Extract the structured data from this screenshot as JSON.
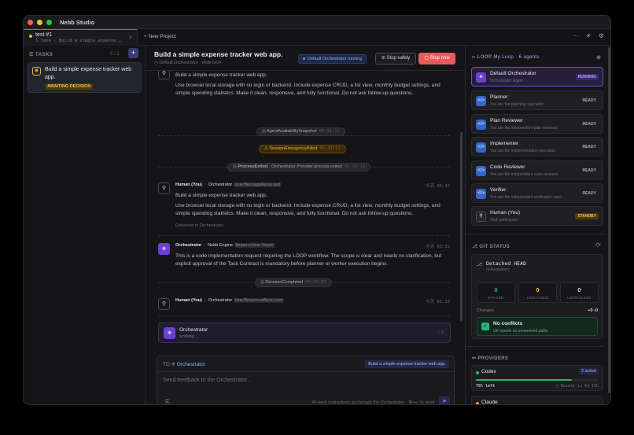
{
  "app": {
    "title": "Nebb Studio"
  },
  "tabs": [
    {
      "title": "test #1",
      "subtitle": "1 Task · Build a simple expense …"
    }
  ],
  "new_project_label": "New Project",
  "colors": {
    "accent": "#6e3fd8",
    "running": "#6b9bff",
    "warning": "#f2c14a",
    "danger": "#e85b5b",
    "success": "#2bb673"
  },
  "tasks": {
    "header": "TASKS",
    "count": "0 / 1",
    "items": [
      {
        "title": "Build a simple expense tracker web app.",
        "status": "AWAITING DECISION"
      }
    ]
  },
  "center": {
    "title": "Build a simple expense tracker web app.",
    "subtitle": "Default Orchestrator · e6de7e04",
    "running_label": "Default Orchestrator running",
    "stop_safely": "Stop safely",
    "stop_now": "Stop now"
  },
  "feed": {
    "msg0": {
      "line1": "Build a simple expense tracker web app.",
      "line2": "Use browser local storage with no login or backend. Include expense CRUD, a list view, monthly budget settings, and simple spending statistics. Make it clean, responsive, and fully functional. Do not ask follow-up questions."
    },
    "events": [
      {
        "label": "AgentAvailabilitySnapshot",
        "time": "05:31:12"
      },
      {
        "label": "SessionEmergencyKilled",
        "time": "05:31:12"
      },
      {
        "label": "ProcessExited",
        "detail": "· Orchestrator Provider process exited",
        "time": "05:31:12"
      }
    ],
    "msg1": {
      "from": "Human (You)",
      "to": "Orchestrator",
      "tag": "UserMessageReceived",
      "time": "今天 05:32",
      "line1": "Build a simple expense tracker web app.",
      "line2": "Use browser local storage with no login or backend. Include expense CRUD, a list view, monthly budget settings, and simple spending statistics. Make it clean, responsive, and fully functional. Do not ask follow-up questions.",
      "delivered": "Delivered to Orchestrator"
    },
    "msg2": {
      "from": "Orchestrator",
      "to": "Nebb Engine",
      "tag": "RequestUserInput",
      "time": "今天 05:32",
      "text": "This is a code implementation request requiring the LOOP workflow. The scope is clear and needs no clarification, but explicit approval of the Task Contract is mandatory before planner or worker execution begins."
    },
    "event_decision": {
      "label": "DecisionCompleted",
      "time": "05:32:33"
    },
    "msg3": {
      "from": "Human (You)",
      "to": "Orchestrator",
      "tag": "UserResponseReceived",
      "time": "今天 05:33"
    },
    "working": {
      "title": "Orchestrator",
      "status": "working",
      "arrow": "↑ 3"
    }
  },
  "composer": {
    "to_label": "TO",
    "to_target": "Orchestrator",
    "chip": "Build a simple expense tracker web app.",
    "placeholder": "Send feedback to the Orchestrator...",
    "hint": "All work instructions go through the Orchestrator · ⌘+↵ to send"
  },
  "loop": {
    "header": "LOOP",
    "name": "My Loop · 6 agents",
    "agents": [
      {
        "name": "Default Orchestrator",
        "sub": "Orchestrator Agent",
        "status": "RUNNING",
        "icon": "orchestrator-icon"
      },
      {
        "name": "Planner",
        "sub": "You are the planning specialist.",
        "status": "READY",
        "icon": "code-icon"
      },
      {
        "name": "Plan Reviewer",
        "sub": "You are the independent plan reviewer.",
        "status": "READY",
        "icon": "code-icon"
      },
      {
        "name": "Implementer",
        "sub": "You are the implementation specialist.",
        "status": "READY",
        "icon": "code-icon"
      },
      {
        "name": "Code Reviewer",
        "sub": "You are the independent code reviewer.",
        "status": "READY",
        "icon": "code-icon"
      },
      {
        "name": "Verifier",
        "sub": "You are the independent verification spec...",
        "status": "READY",
        "icon": "code-icon"
      },
      {
        "name": "Human (You)",
        "sub": "Task participant",
        "status": "STANDBY",
        "icon": "person-icon"
      }
    ]
  },
  "git": {
    "header": "GIT STATUS",
    "head": "Detached HEAD",
    "repo": "noRepository",
    "staged": "0",
    "staged_label": "STAGED",
    "unstaged": "0",
    "unstaged_label": "UNSTAGED",
    "untracked": "0",
    "untracked_label": "UNTRACKED",
    "changes_label": "Changes",
    "changes_value": "+0  -0",
    "conflict_title": "No conflicts",
    "conflict_sub": "Git reports no unresolved paths"
  },
  "providers": {
    "header": "PROVIDERS",
    "items": [
      {
        "name": "Codex",
        "badge": "2 active",
        "left": "78% left",
        "reset": "Resets in 4d 10h",
        "usage_fraction": 0.78
      },
      {
        "name": "Claude"
      }
    ]
  }
}
